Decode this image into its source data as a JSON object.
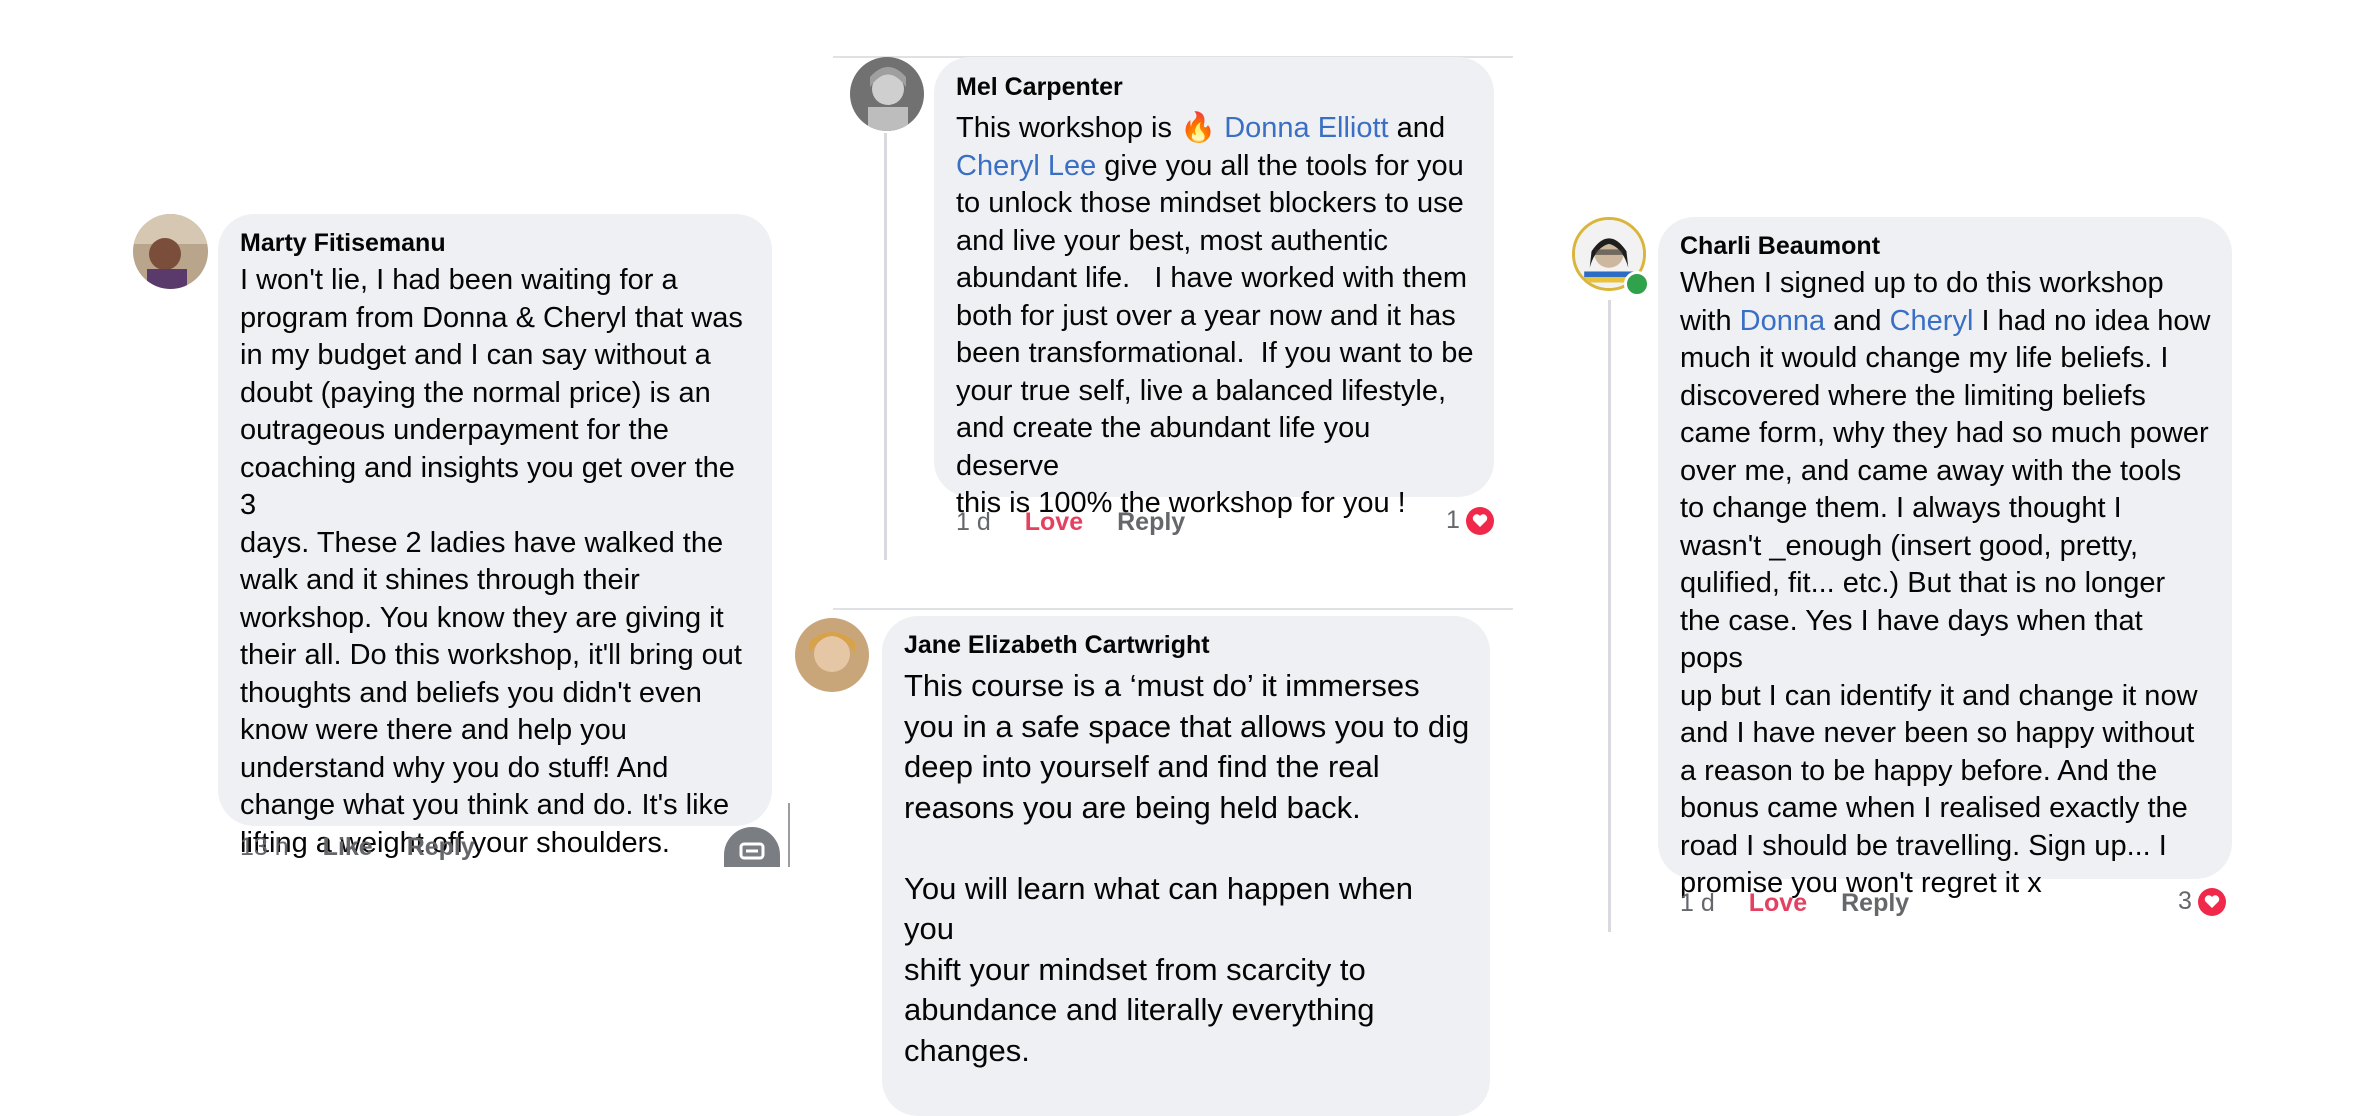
{
  "comments": [
    {
      "author": "Marty Fitisemanu",
      "text": "I won't lie, I had been waiting for a\nprogram from Donna & Cheryl that was\nin my budget and I can say without a\ndoubt (paying the normal price) is an\noutrageous underpayment for the\ncoaching and insights you get over the 3\ndays. These 2 ladies have walked the\nwalk and it shines through their\nworkshop. You know they are giving it\ntheir all. Do this workshop, it'll bring out\nthoughts and beliefs you didn't even\nknow were there and help you\nunderstand why you do stuff! And\nchange what you think and do. It's like\nlifting a weight off your shoulders.",
      "time": "13 h",
      "like_label": "Like",
      "reply_label": "Reply"
    },
    {
      "author": "Mel Carpenter",
      "text_before": "This workshop is ",
      "emoji": "🔥",
      "mention_1": "Donna Elliott",
      "text_mid": " and",
      "mention_2": "Cheryl Lee",
      "text_after": " give you all the tools for you\nto unlock those mindset blockers to use\nand live your best, most authentic\nabundant life.   I have worked with them\nboth for just over a year now and it has\nbeen transformational.  If you want to be\nyour true self, live a balanced lifestyle,\nand create the abundant life you deserve\nthis is 100% the workshop for you !",
      "time": "1 d",
      "love_label": "Love",
      "reply_label": "Reply",
      "reaction_count": "1"
    },
    {
      "author": "Jane Elizabeth Cartwright",
      "text": "This course is a ‘must do’ it immerses\nyou in a safe space that allows you to dig\ndeep into yourself and find the real\nreasons you are being held back.\n\nYou will learn what can happen when you\nshift your mindset from scarcity to\nabundance and literally everything\nchanges."
    },
    {
      "author": "Charli Beaumont",
      "text_before": "When I signed up to do this workshop\nwith ",
      "mention_1": "Donna",
      "text_mid": " and ",
      "mention_2": "Cheryl",
      "text_after": " I had no idea how\nmuch it would change my life beliefs. I\ndiscovered where the limiting beliefs\ncame form, why they had so much power\nover me, and came away with the tools\nto change them. I always thought I\nwasn't _enough (insert good, pretty,\nqulified, fit... etc.) But that is no longer\nthe case. Yes I have days when that pops\nup but I can identify it and change it now\nand I have never been so happy without\na reason to be happy before. And the\nbonus came when I realised exactly the\nroad I should be travelling. Sign up... I\npromise you won't regret it x",
      "time": "1 d",
      "love_label": "Love",
      "reply_label": "Reply",
      "reaction_count": "3"
    }
  ],
  "colors": {
    "bubble": "#eef0f3",
    "mention": "#3a6fc4",
    "love": "#e4405f",
    "meta": "#65676b",
    "online": "#31a24c"
  },
  "icons": [
    "heart-icon",
    "online-status-icon",
    "floating-action-icon"
  ]
}
